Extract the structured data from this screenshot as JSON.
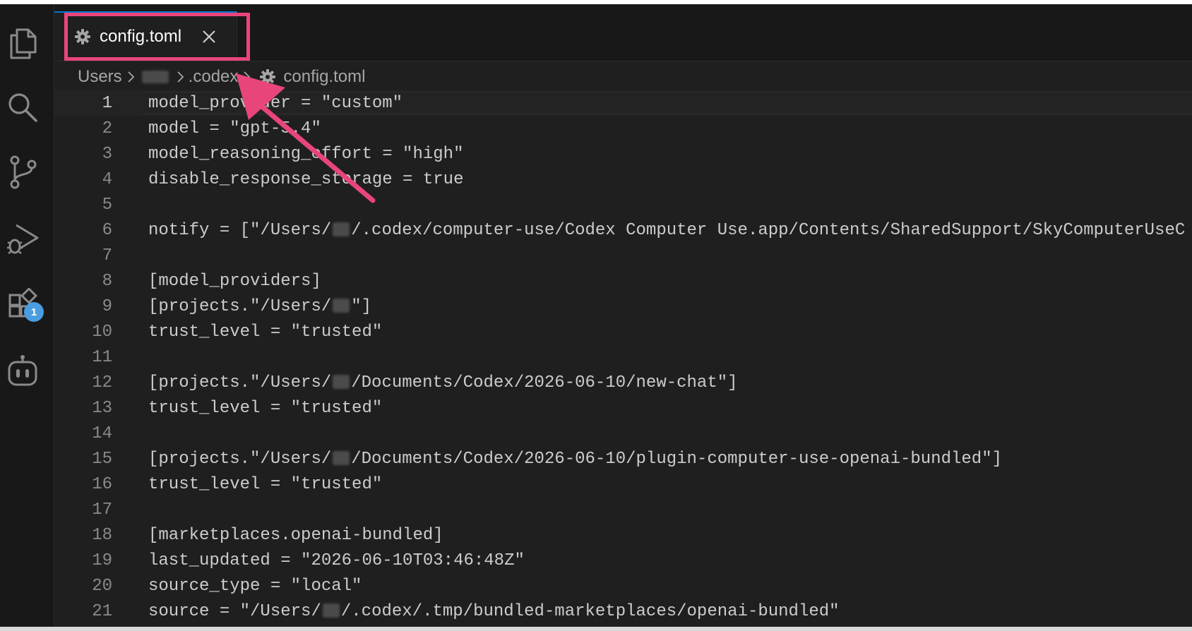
{
  "tab": {
    "title": "config.toml",
    "icon": "gear-icon",
    "close_icon": "close-icon"
  },
  "activity_bar": {
    "items": [
      {
        "name": "explorer",
        "icon": "files-icon"
      },
      {
        "name": "search",
        "icon": "search-icon"
      },
      {
        "name": "source-control",
        "icon": "source-control-icon"
      },
      {
        "name": "run-debug",
        "icon": "run-debug-icon"
      },
      {
        "name": "extensions",
        "icon": "extensions-icon",
        "badge": "1"
      },
      {
        "name": "copilot",
        "icon": "robot-icon"
      }
    ]
  },
  "breadcrumbs": {
    "users": "Users",
    "codex": ".codex",
    "file": "config.toml"
  },
  "colors": {
    "highlight": "#e8467a",
    "badge": "#4a9de0",
    "editor_bg": "#1f1f1f",
    "text": "#cccccc"
  },
  "editor": {
    "active_line": "1",
    "lines": [
      {
        "num": "1",
        "pre": "model_provider = \"custom\""
      },
      {
        "num": "2",
        "pre": "model = \"gpt-5.4\""
      },
      {
        "num": "3",
        "pre": "model_reasoning_effort = \"high\""
      },
      {
        "num": "4",
        "pre": "disable_response_storage = true"
      },
      {
        "num": "5",
        "pre": ""
      },
      {
        "num": "6",
        "pre": "notify = [\"/Users/",
        "post": "/.codex/computer-use/Codex Computer Use.app/Contents/SharedSupport/SkyComputerUseC"
      },
      {
        "num": "7",
        "pre": ""
      },
      {
        "num": "8",
        "pre": "[model_providers]"
      },
      {
        "num": "9",
        "pre": "[projects.\"/Users/",
        "post": "\"]"
      },
      {
        "num": "10",
        "pre": "trust_level = \"trusted\""
      },
      {
        "num": "11",
        "pre": ""
      },
      {
        "num": "12",
        "pre": "[projects.\"/Users/",
        "post": "/Documents/Codex/2026-06-10/new-chat\"]"
      },
      {
        "num": "13",
        "pre": "trust_level = \"trusted\""
      },
      {
        "num": "14",
        "pre": ""
      },
      {
        "num": "15",
        "pre": "[projects.\"/Users/",
        "post": "/Documents/Codex/2026-06-10/plugin-computer-use-openai-bundled\"]"
      },
      {
        "num": "16",
        "pre": "trust_level = \"trusted\""
      },
      {
        "num": "17",
        "pre": ""
      },
      {
        "num": "18",
        "pre": "[marketplaces.openai-bundled]"
      },
      {
        "num": "19",
        "pre": "last_updated = \"2026-06-10T03:46:48Z\""
      },
      {
        "num": "20",
        "pre": "source_type = \"local\""
      },
      {
        "num": "21",
        "pre": "source = \"/Users/",
        "post": "/.codex/.tmp/bundled-marketplaces/openai-bundled\""
      }
    ]
  }
}
